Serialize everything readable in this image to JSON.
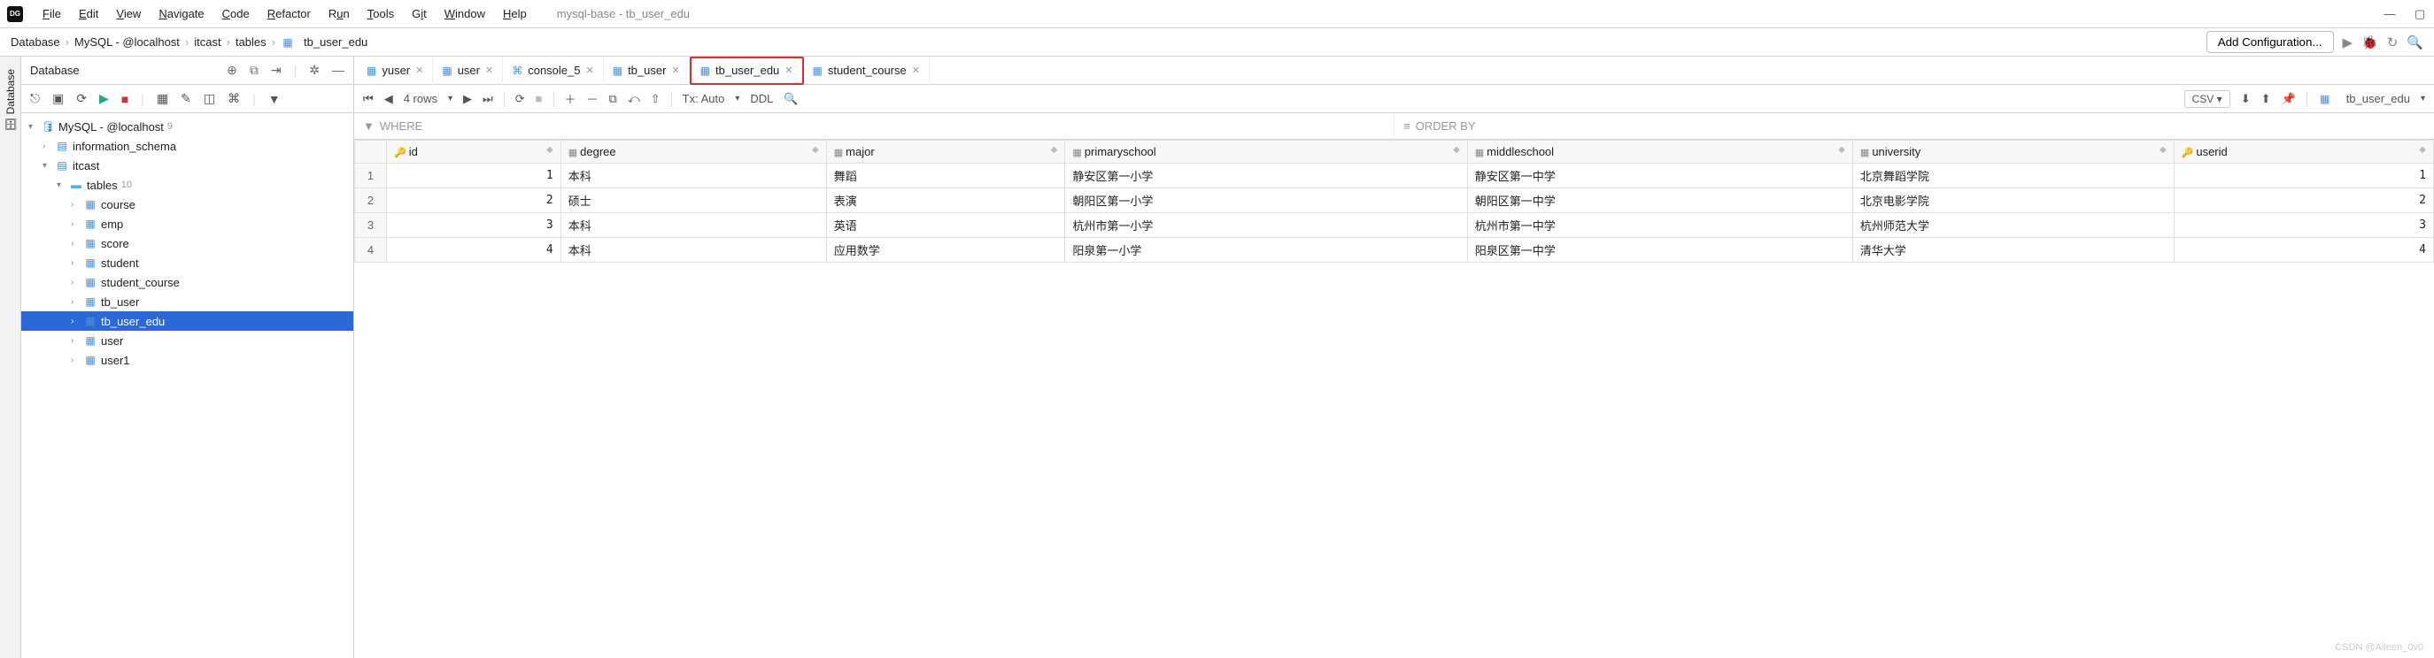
{
  "window": {
    "title": "mysql-base - tb_user_edu",
    "app_badge": "DG"
  },
  "menubar": [
    "File",
    "Edit",
    "View",
    "Navigate",
    "Code",
    "Refactor",
    "Run",
    "Tools",
    "Git",
    "Window",
    "Help"
  ],
  "breadcrumb": [
    "Database",
    "MySQL - @localhost",
    "itcast",
    "tables",
    "tb_user_edu"
  ],
  "config_button": "Add Configuration...",
  "side_panel_label": "Database",
  "tree_header": "Database",
  "tree": {
    "root": {
      "label": "MySQL - @localhost",
      "count": "9"
    },
    "schemas": [
      {
        "label": "information_schema"
      },
      {
        "label": "itcast",
        "expanded": true,
        "tables_label": "tables",
        "tables_count": "10",
        "tables": [
          "course",
          "emp",
          "score",
          "student",
          "student_course",
          "tb_user",
          "tb_user_edu",
          "user",
          "user1"
        ],
        "selected": "tb_user_edu"
      }
    ]
  },
  "tabs": [
    {
      "label": "yuser",
      "type": "table"
    },
    {
      "label": "user",
      "type": "table"
    },
    {
      "label": "console_5",
      "type": "console"
    },
    {
      "label": "tb_user",
      "type": "table"
    },
    {
      "label": "tb_user_edu",
      "type": "table",
      "active": true
    },
    {
      "label": "student_course",
      "type": "table"
    }
  ],
  "data_toolbar": {
    "rows": "4 rows",
    "tx": "Tx: Auto",
    "ddl": "DDL",
    "csv": "CSV",
    "target": "tb_user_edu"
  },
  "filter": {
    "where": "WHERE",
    "orderby": "ORDER BY"
  },
  "columns": [
    {
      "name": "id",
      "key": true,
      "numeric": true
    },
    {
      "name": "degree"
    },
    {
      "name": "major"
    },
    {
      "name": "primaryschool"
    },
    {
      "name": "middleschool"
    },
    {
      "name": "university"
    },
    {
      "name": "userid",
      "key": true,
      "numeric": true
    }
  ],
  "rows": [
    {
      "n": "1",
      "cells": [
        "1",
        "本科",
        "舞蹈",
        "静安区第一小学",
        "静安区第一中学",
        "北京舞蹈学院",
        "1"
      ]
    },
    {
      "n": "2",
      "cells": [
        "2",
        "硕士",
        "表演",
        "朝阳区第一小学",
        "朝阳区第一中学",
        "北京电影学院",
        "2"
      ]
    },
    {
      "n": "3",
      "cells": [
        "3",
        "本科",
        "英语",
        "杭州市第一小学",
        "杭州市第一中学",
        "杭州师范大学",
        "3"
      ]
    },
    {
      "n": "4",
      "cells": [
        "4",
        "本科",
        "应用数学",
        "阳泉第一小学",
        "阳泉区第一中学",
        "清华大学",
        "4"
      ]
    }
  ],
  "watermark": "CSDN @Aileen_0v0"
}
